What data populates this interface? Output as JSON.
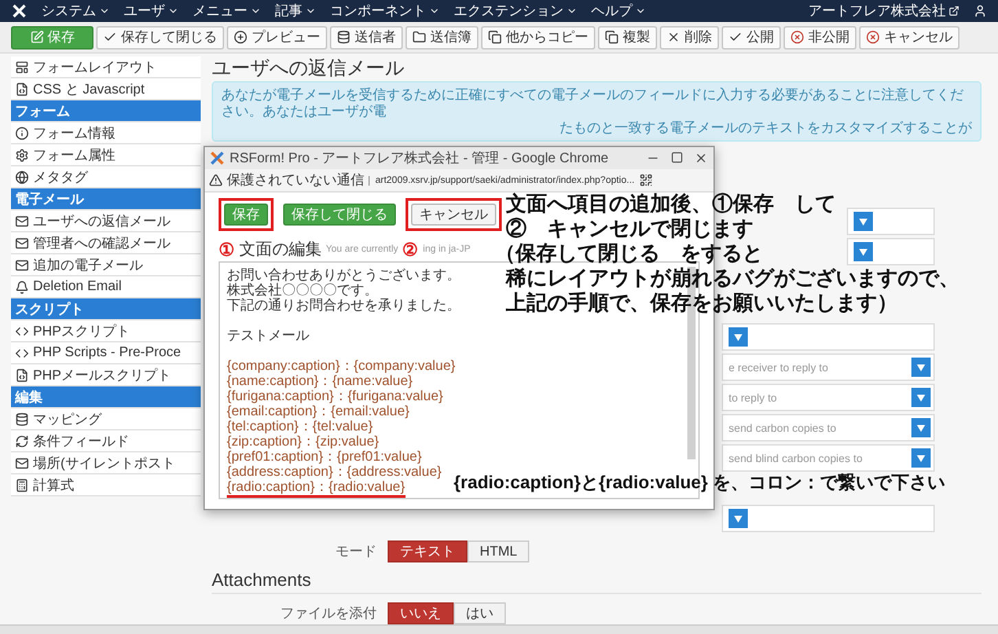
{
  "top_menu": {
    "items": [
      "システム",
      "ユーザ",
      "メニュー",
      "記事",
      "コンポーネント",
      "エクステンション",
      "ヘルプ"
    ],
    "site_name": "アートフレア株式会社"
  },
  "toolbar": {
    "buttons": [
      {
        "label": "保存",
        "kind": "primary"
      },
      {
        "label": "保存して閉じる",
        "kind": "default"
      },
      {
        "label": "プレビュー",
        "kind": "default"
      },
      {
        "label": "送信者",
        "kind": "default"
      },
      {
        "label": "送信簿",
        "kind": "default"
      },
      {
        "label": "他からコピー",
        "kind": "default"
      },
      {
        "label": "複製",
        "kind": "default"
      },
      {
        "label": "削除",
        "kind": "default"
      },
      {
        "label": "公開",
        "kind": "default"
      },
      {
        "label": "非公開",
        "kind": "default"
      },
      {
        "label": "キャンセル",
        "kind": "default"
      }
    ]
  },
  "sidebar": {
    "items": [
      {
        "label": "フォームレイアウト",
        "kind": "link"
      },
      {
        "label": "CSS と Javascript",
        "kind": "link"
      },
      {
        "label": "フォーム",
        "kind": "header"
      },
      {
        "label": "フォーム情報",
        "kind": "link"
      },
      {
        "label": "フォーム属性",
        "kind": "link"
      },
      {
        "label": "メタタグ",
        "kind": "link"
      },
      {
        "label": "電子メール",
        "kind": "header"
      },
      {
        "label": "ユーザへの返信メール",
        "kind": "link"
      },
      {
        "label": "管理者への確認メール",
        "kind": "link"
      },
      {
        "label": "追加の電子メール",
        "kind": "link"
      },
      {
        "label": "Deletion Email",
        "kind": "link"
      },
      {
        "label": "スクリプト",
        "kind": "header"
      },
      {
        "label": "PHPスクリプト",
        "kind": "link"
      },
      {
        "label": "PHP Scripts - Pre-Proce",
        "kind": "link"
      },
      {
        "label": "PHPメールスクリプト",
        "kind": "link"
      },
      {
        "label": "編集",
        "kind": "header"
      },
      {
        "label": "マッピング",
        "kind": "link"
      },
      {
        "label": "条件フィールド",
        "kind": "link"
      },
      {
        "label": "場所(サイレントポスト",
        "kind": "link"
      },
      {
        "label": "計算式",
        "kind": "link"
      }
    ]
  },
  "page": {
    "title": "ユーザへの返信メール",
    "notice": [
      "あなたが電子メールを受信するために正確にすべての電子メールのフィールドに入力する必要があることに注意してください。あなたはユーザが電",
      "たものと一致する電子メールのテキストをカスタマイズすることが"
    ],
    "field_groups": [
      [
        {
          "kind": "select"
        },
        {
          "kind": "select"
        }
      ],
      [
        {
          "kind": "select"
        },
        {
          "kind": "select",
          "placeholder": "e receiver to reply to"
        },
        {
          "kind": "select",
          "placeholder": "to reply to"
        },
        {
          "kind": "select",
          "placeholder": "send carbon copies to"
        },
        {
          "kind": "select",
          "placeholder": "send blind carbon copies to"
        }
      ],
      [
        {
          "kind": "select"
        }
      ]
    ],
    "mode": {
      "label": "モード",
      "options": [
        {
          "label": "テキスト",
          "selected": true
        },
        {
          "label": "HTML",
          "selected": false
        }
      ]
    },
    "attachments": {
      "title": "Attachments",
      "label": "ファイルを添付",
      "options": [
        {
          "label": "いいえ",
          "selected": true
        },
        {
          "label": "はい",
          "selected": false
        }
      ]
    }
  },
  "popup": {
    "title": "RSForm! Pro - アートフレア株式会社 - 管理 - Google Chrome",
    "security": "保護されていない通信",
    "url": "art2009.xsrv.jp/support/saeki/administrator/index.php?optio...",
    "buttons": [
      {
        "label": "保存",
        "kind": "primary",
        "highlighted": true
      },
      {
        "label": "保存して閉じる",
        "kind": "primary",
        "highlighted": false
      },
      {
        "label": "キャンセル",
        "kind": "default",
        "highlighted": true
      }
    ],
    "heading": "文面の編集",
    "note_start": "You are currently",
    "note_end": "ing in ja-JP",
    "body": [
      [
        {
          "text": "お問い合わせありがとうございます。",
          "underlined": false
        },
        {
          "text": "株式会社〇〇〇〇です。",
          "underlined": false
        },
        {
          "text": "下記の通りお問合わせを承りました。",
          "underlined": false
        }
      ],
      [
        {
          "text": "テストメール",
          "underlined": false
        }
      ],
      [
        {
          "text": "{company:caption}：{company:value}",
          "underlined": false
        },
        {
          "text": "{name:caption}：{name:value}",
          "underlined": false
        },
        {
          "text": "{furigana:caption}：{furigana:value}",
          "underlined": false
        },
        {
          "text": "{email:caption}：{email:value}",
          "underlined": false
        },
        {
          "text": "{tel:caption}：{tel:value}",
          "underlined": false
        },
        {
          "text": "{zip:caption}：{zip:value}",
          "underlined": false
        },
        {
          "text": "{pref01:caption}：{pref01:value}",
          "underlined": false
        },
        {
          "text": "{address:caption}：{address:value}",
          "underlined": false
        },
        {
          "text": "{radio:caption}：{radio:value}",
          "underlined": true
        }
      ]
    ]
  },
  "annotations": {
    "markers": [
      "①",
      "②"
    ],
    "instructions": [
      "文面へ項目の追加後、①保存　して",
      "②　キャンセルで閉じます",
      "（保存して閉じる　をすると",
      "稀にレイアウトが崩れるバグがございますので、",
      "上記の手順で、保存をお願いいたします）"
    ],
    "tip": "{radio:caption}と{radio:value} を、コロン：で繋いで下さい"
  }
}
